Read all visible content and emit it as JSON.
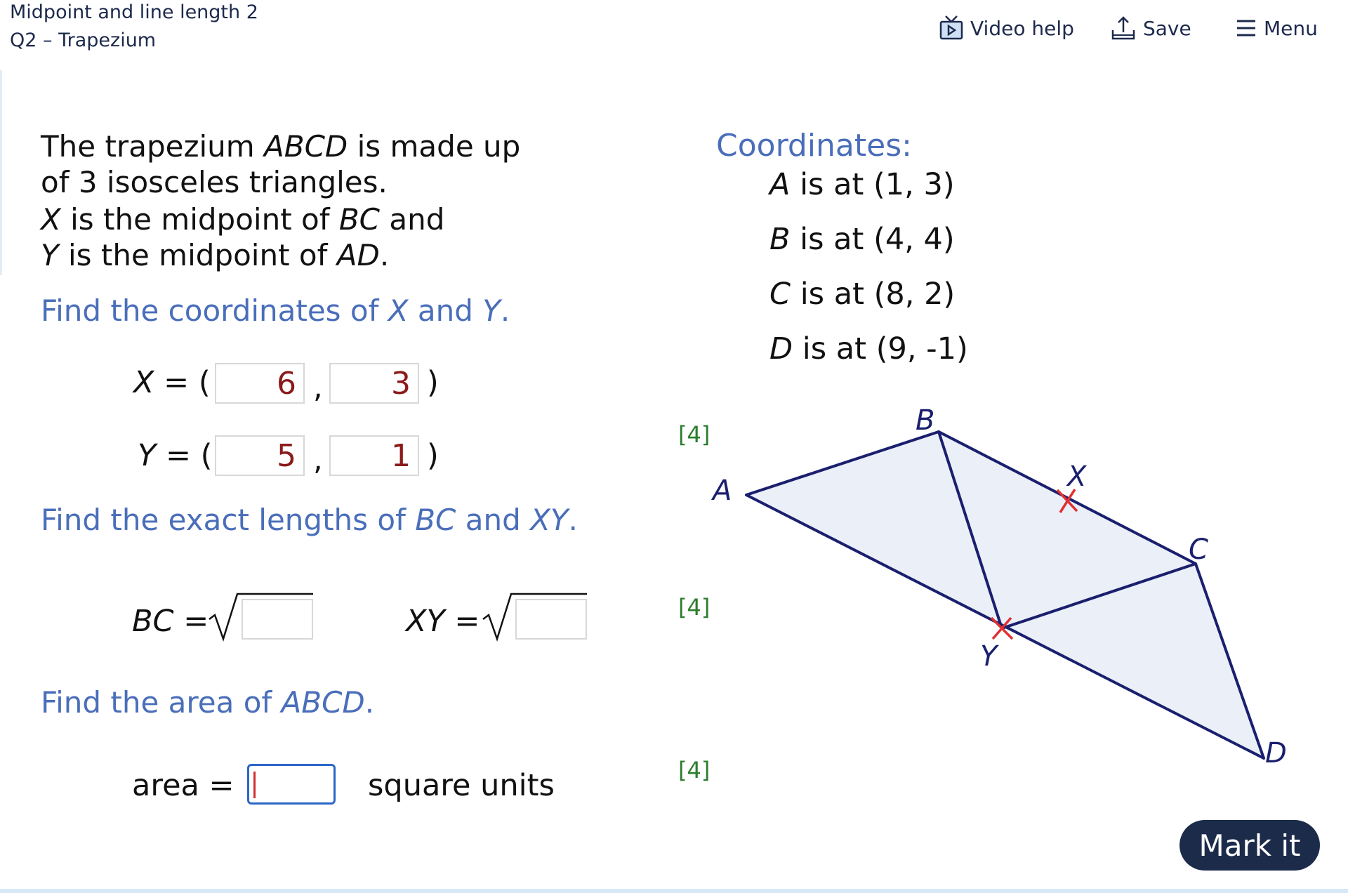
{
  "header": {
    "title": "Midpoint and line length 2",
    "subtitle": "Q2 – Trapezium",
    "video_help": "Video help",
    "save": "Save",
    "menu": "Menu"
  },
  "question": {
    "line1": "The trapezium ",
    "abcd": "ABCD",
    "line1b": " is made up",
    "line2": "of 3 isosceles triangles.",
    "line3a": "X",
    "line3b": " is the midpoint of ",
    "line3c": "BC",
    "line3d": " and",
    "line4a": "Y",
    "line4b": " is the midpoint of ",
    "line4c": "AD",
    "line4d": "."
  },
  "part1": {
    "prompt_a": "Find the coordinates of ",
    "prompt_x": "X",
    "prompt_and": " and ",
    "prompt_y": "Y",
    "prompt_end": ".",
    "x_label": "X",
    "y_label": "Y",
    "equals_open": " = (",
    "comma": ",",
    "close": ")",
    "x_val1": "6",
    "x_val2": "3",
    "y_val1": "5",
    "y_val2": "1",
    "marks": "[4]"
  },
  "part2": {
    "prompt_a": "Find the exact lengths of ",
    "prompt_bc": "BC",
    "prompt_and": " and ",
    "prompt_xy": "XY",
    "prompt_end": ".",
    "bc_label": "BC",
    "xy_label": "XY",
    "equals": " =",
    "bc_value": "",
    "xy_value": "",
    "marks": "[4]"
  },
  "part3": {
    "prompt_a": "Find the area of ",
    "prompt_abcd": "ABCD",
    "prompt_end": ".",
    "area_label": "area = ",
    "units": "square units",
    "value": "",
    "marks": "[4]"
  },
  "coordinates": {
    "heading": "Coordinates:",
    "items": [
      {
        "letter": "A",
        "text": " is at (1, 3)"
      },
      {
        "letter": "B",
        "text": " is at (4, 4)"
      },
      {
        "letter": "C",
        "text": " is at (8, 2)"
      },
      {
        "letter": "D",
        "text": " is at (9, -1)"
      }
    ]
  },
  "diagram": {
    "labels": {
      "A": "A",
      "B": "B",
      "C": "C",
      "D": "D",
      "X": "X",
      "Y": "Y"
    },
    "fill": "#ebeff8",
    "stroke": "#1a1f6e",
    "midpoint_color": "#e03030"
  },
  "mark_button": "Mark it",
  "colors": {
    "accent": "#4a6eba",
    "answer": "#8b1a1a",
    "marks": "#2d7d2d",
    "button": "#1c2b4a"
  }
}
